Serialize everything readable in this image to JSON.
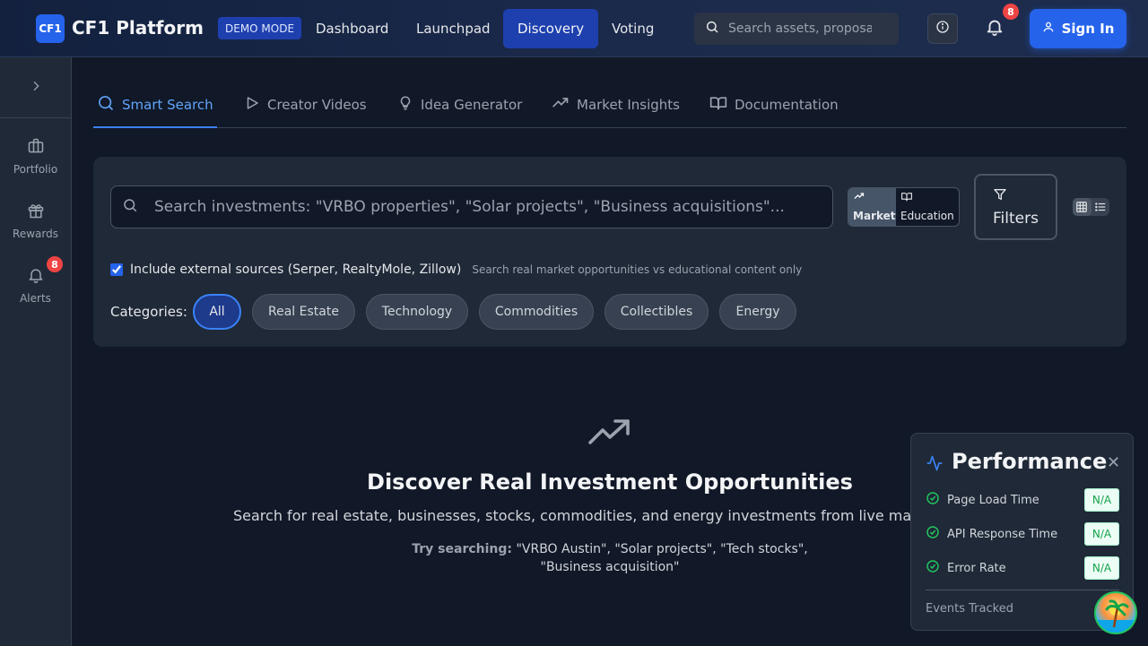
{
  "header": {
    "logo_text": "CF1",
    "brand": "CF1 Platform",
    "demo_badge": "DEMO MODE",
    "nav": [
      "Dashboard",
      "Launchpad",
      "Discovery",
      "Voting"
    ],
    "active_nav": "Discovery",
    "search_placeholder": "Search assets, proposals...",
    "notification_count": "8",
    "sign_in": "Sign In"
  },
  "sidebar": {
    "items": [
      {
        "label": "Portfolio",
        "icon": "briefcase-icon"
      },
      {
        "label": "Rewards",
        "icon": "gift-icon"
      },
      {
        "label": "Alerts",
        "icon": "bell-icon",
        "badge": "8"
      }
    ]
  },
  "tabs": [
    {
      "label": "Smart Search",
      "icon": "search-icon",
      "active": true
    },
    {
      "label": "Creator Videos",
      "icon": "play-icon"
    },
    {
      "label": "Idea Generator",
      "icon": "lightbulb-icon"
    },
    {
      "label": "Market Insights",
      "icon": "trending-up-icon"
    },
    {
      "label": "Documentation",
      "icon": "book-icon"
    }
  ],
  "search": {
    "placeholder": "Search investments: \"VRBO properties\", \"Solar projects\", \"Business acquisitions\"...",
    "modes": [
      "Market",
      "Education"
    ],
    "active_mode": "Market",
    "filters_label": "Filters",
    "external_label": "Include external sources (Serper, RealtyMole, Zillow)",
    "external_checked": true,
    "external_hint": "Search real market opportunities vs educational content only",
    "categories_label": "Categories:",
    "categories": [
      "All",
      "Real Estate",
      "Technology",
      "Commodities",
      "Collectibles",
      "Energy"
    ],
    "active_category": "All"
  },
  "empty_state": {
    "title": "Discover Real Investment Opportunities",
    "subtitle": "Search for real estate, businesses, stocks, commodities, and energy investments from live market data",
    "try_label": "Try searching:",
    "try_text": "\"VRBO Austin\", \"Solar projects\", \"Tech stocks\", \"Business acquisition\""
  },
  "performance": {
    "title": "Performance",
    "metrics": [
      {
        "label": "Page Load Time",
        "value": "N/A"
      },
      {
        "label": "API Response Time",
        "value": "N/A"
      },
      {
        "label": "Error Rate",
        "value": "N/A"
      }
    ],
    "footer": "Events Tracked"
  },
  "colors": {
    "accent": "#2563eb",
    "background": "#111827",
    "panel": "#1f2937",
    "success": "#22c55e",
    "badge": "#ef4444"
  }
}
